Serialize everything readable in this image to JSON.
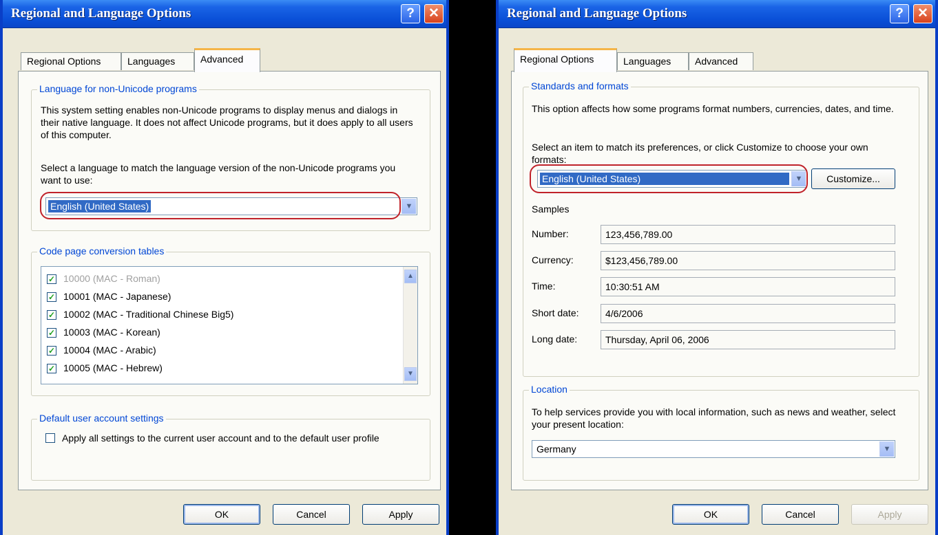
{
  "left_window": {
    "title": "Regional and Language Options",
    "help_button": "?",
    "close_button": "✕",
    "tabs": [
      "Regional Options",
      "Languages",
      "Advanced"
    ],
    "active_tab": "Advanced",
    "non_unicode_group": {
      "label": "Language for non-Unicode programs",
      "description": "This system setting enables non-Unicode programs to display menus and dialogs in their native language. It does not affect Unicode programs, but it does apply to all users of this computer.",
      "prompt": "Select a language to match the language version of the non-Unicode programs you want to use:",
      "selected_language": "English (United States)"
    },
    "code_page_group": {
      "label": "Code page conversion tables",
      "items": [
        {
          "label": "10000 (MAC - Roman)",
          "checked": true,
          "disabled": true
        },
        {
          "label": "10001 (MAC - Japanese)",
          "checked": true,
          "disabled": false
        },
        {
          "label": "10002 (MAC - Traditional Chinese Big5)",
          "checked": true,
          "disabled": false
        },
        {
          "label": "10003 (MAC - Korean)",
          "checked": true,
          "disabled": false
        },
        {
          "label": "10004 (MAC - Arabic)",
          "checked": true,
          "disabled": false
        },
        {
          "label": "10005 (MAC - Hebrew)",
          "checked": true,
          "disabled": false
        }
      ]
    },
    "default_user_group": {
      "label": "Default user account settings",
      "checkbox_label": "Apply all settings to the current user account and to the default user profile",
      "checked": false
    },
    "buttons": {
      "ok": "OK",
      "cancel": "Cancel",
      "apply": "Apply"
    }
  },
  "right_window": {
    "title": "Regional and Language Options",
    "help_button": "?",
    "close_button": "✕",
    "tabs": [
      "Regional Options",
      "Languages",
      "Advanced"
    ],
    "active_tab": "Regional Options",
    "standards_group": {
      "label": "Standards and formats",
      "description": "This option affects how some programs format numbers, currencies, dates, and time.",
      "prompt": "Select an item to match its preferences, or click Customize to choose your own formats:",
      "selected_format": "English (United States)",
      "customize_button": "Customize...",
      "samples_label": "Samples",
      "samples": [
        {
          "label": "Number:",
          "value": "123,456,789.00"
        },
        {
          "label": "Currency:",
          "value": "$123,456,789.00"
        },
        {
          "label": "Time:",
          "value": "10:30:51 AM"
        },
        {
          "label": "Short date:",
          "value": "4/6/2006"
        },
        {
          "label": "Long date:",
          "value": "Thursday, April 06, 2006"
        }
      ]
    },
    "location_group": {
      "label": "Location",
      "description": "To help services provide you with local information, such as news and weather, select your present location:",
      "selected_location": "Germany"
    },
    "buttons": {
      "ok": "OK",
      "cancel": "Cancel",
      "apply": "Apply"
    }
  },
  "colors": {
    "title_bar": "#0a50d8",
    "group_label": "#0046d5",
    "selection": "#316ac5",
    "highlight_ring": "#c0222a"
  }
}
